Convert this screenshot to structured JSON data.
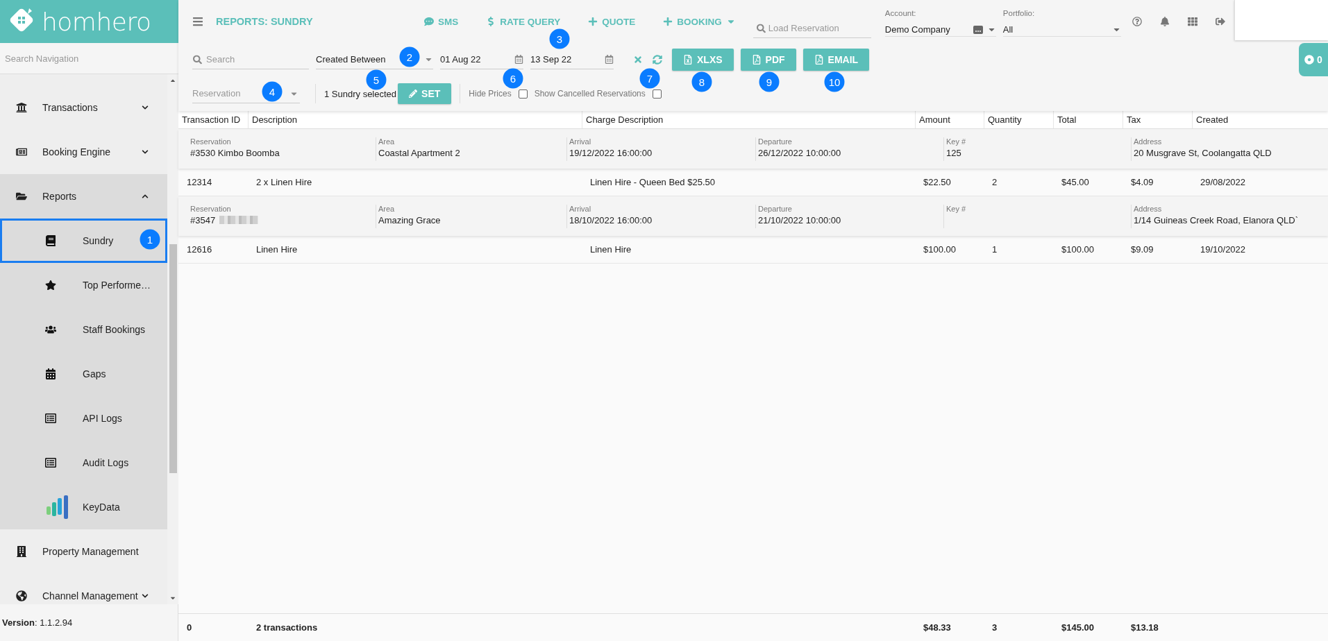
{
  "brand": {
    "name": "homhero"
  },
  "sidebar": {
    "search_placeholder": "Search Navigation",
    "items": [
      {
        "label": "Transactions",
        "expanded": false
      },
      {
        "label": "Booking Engine",
        "expanded": false
      },
      {
        "label": "Reports",
        "expanded": true,
        "children": [
          {
            "label": "Sundry",
            "selected": true
          },
          {
            "label": "Top Performe…",
            "selected": false
          },
          {
            "label": "Staff Bookings",
            "selected": false
          },
          {
            "label": "Gaps",
            "selected": false
          },
          {
            "label": "API Logs",
            "selected": false
          },
          {
            "label": "Audit Logs",
            "selected": false
          },
          {
            "label": "KeyData",
            "selected": false
          }
        ]
      },
      {
        "label": "Property Management"
      },
      {
        "label": "Channel Management",
        "expanded": false
      }
    ],
    "version": "**Version**: 1.1.2.94"
  },
  "header": {
    "title": "REPORTS: SUNDRY",
    "actions": [
      {
        "label": "SMS",
        "dropdown": false
      },
      {
        "label": "RATE QUERY",
        "dropdown": false
      },
      {
        "label": "QUOTE",
        "dropdown": false
      },
      {
        "label": "BOOKING",
        "dropdown": true
      }
    ],
    "load_reservation": {
      "placeholder": "Load Reservation"
    },
    "account": {
      "label": "Account:",
      "value": "Demo Company"
    },
    "portfolio": {
      "label": "Portfolio:",
      "value": "All"
    }
  },
  "status_badge": {
    "count": "0"
  },
  "filters": {
    "search": {
      "placeholder": "Search"
    },
    "date_filter": {
      "value": "Created Between"
    },
    "from_date": {
      "value": "01 Aug 22"
    },
    "to_date": {
      "value": "13 Sep 22"
    },
    "exports": [
      {
        "label": "XLXS"
      },
      {
        "label": "PDF"
      },
      {
        "label": "EMAIL"
      }
    ],
    "reservation": {
      "placeholder": "Reservation"
    },
    "selection": "1 Sundry selected",
    "set_button": "SET",
    "options": [
      {
        "label": "Hide Prices",
        "checked": false
      },
      {
        "label": "Show Cancelled Reservations",
        "checked": false
      }
    ]
  },
  "table": {
    "columns": [
      "Transaction ID",
      "Description",
      "Charge Description",
      "Amount",
      "Quantity",
      "Total",
      "Tax",
      "Created"
    ],
    "groups": [
      {
        "reservation": [
          {
            "label": "Reservation",
            "value": "#3530 Kimbo Boomba"
          },
          {
            "label": "Area",
            "value": "Coastal Apartment 2"
          },
          {
            "label": "Arrival",
            "value": "19/12/2022 16:00:00"
          },
          {
            "label": "Departure",
            "value": "26/12/2022 10:00:00"
          },
          {
            "label": "Key #",
            "value": "125"
          },
          {
            "label": "Address",
            "value": "20 Musgrave St, Coolangatta QLD"
          }
        ],
        "rows": [
          [
            "12314",
            "2 x Linen Hire",
            "Linen Hire - Queen Bed $25.50",
            "$22.50",
            "2",
            "$45.00",
            "$4.09",
            "29/08/2022"
          ]
        ]
      },
      {
        "reservation": [
          {
            "label": "Reservation",
            "value": "#3547",
            "redacted": true
          },
          {
            "label": "Area",
            "value": "Amazing Grace"
          },
          {
            "label": "Arrival",
            "value": "18/10/2022 16:00:00"
          },
          {
            "label": "Departure",
            "value": "21/10/2022 10:00:00"
          },
          {
            "label": "Key #"
          },
          {
            "label": "Address",
            "value": "1/14 Guineas Creek Road, Elanora QLD`"
          }
        ],
        "rows": [
          [
            "12616",
            "Linen Hire",
            "Linen Hire",
            "$100.00",
            "1",
            "$100.00",
            "$9.09",
            "19/10/2022"
          ]
        ]
      }
    ],
    "totals": {
      "transaction_id": "0",
      "description": "2 transactions",
      "amount": "$48.33",
      "quantity": "3",
      "total": "$145.00",
      "tax": "$13.18"
    }
  },
  "callouts": [
    {
      "number": "1"
    },
    {
      "number": "2"
    },
    {
      "number": "3"
    },
    {
      "number": "4"
    },
    {
      "number": "5"
    },
    {
      "number": "6"
    },
    {
      "number": "7"
    },
    {
      "number": "8"
    },
    {
      "number": "9"
    },
    {
      "number": "10"
    }
  ]
}
